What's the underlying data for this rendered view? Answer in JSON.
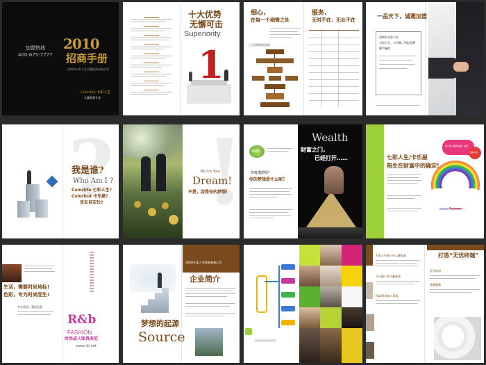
{
  "cover": {
    "hotline_label": "加盟热线",
    "hotline_number": "400-675-7777",
    "year": "2010",
    "title": "招商手册",
    "company_note": "深圳市七彩人生儿童家具有限公司",
    "brand": "Colorlife 七彩人生",
    "brand_sub": "儿童家具专卖"
  },
  "superiority": {
    "title_cn_line1": "十大优势",
    "title_cn_line2": "无懈可击",
    "title_en": "Superiority",
    "big_number": "1"
  },
  "service": {
    "left_line1": "细心，",
    "left_line2": "在每一个细微之处",
    "right_line1": "服务，",
    "right_line2": "无时不在，无处不在",
    "flow_label": "三大品牌规划流程"
  },
  "partner": {
    "title": "一品天下，诚邀加盟",
    "company_line1": "深圳市七彩人生",
    "company_line2": "七彩人生，卡乐屋，色彩品牌",
    "company_line3": "客户服务"
  },
  "whoami": {
    "title_cn": "我是谁?",
    "title_en": "Who Am I ?",
    "line1": "Colorlife 七彩人生?",
    "line2": "Colorbut 卡乐屋?",
    "line3": "良友自安社?"
  },
  "dream": {
    "title_en": "Dream!",
    "subtitle": "No,I'm Your",
    "caption": "不是，我是你的梦想!"
  },
  "question": {
    "q1": "你有理想吗？",
    "q2": "你的梦想是什么呢？",
    "bubble": "我的梦想"
  },
  "wealth": {
    "title_en": "Wealth",
    "title_cn_line1": "财富之门，",
    "title_cn_line2": "已经打开……"
  },
  "kids": {
    "heading_line1": "七彩人生/卡乐屋",
    "heading_line2": "陪生在财富中的确定!",
    "bubble": "青少年儿童家具第一品牌",
    "url": "www.7cj.com",
    "badge": "七彩人生"
  },
  "fashion": {
    "text_line1": "生活，需要时尚地标!",
    "text_line2": "色彩，专为时尚而生!",
    "sub": "专业家居，潮流无限",
    "logo": "R&b",
    "logo_en": "FASHION",
    "logo_cn": "时尚成人家具典范",
    "url": "www.rbj.net"
  },
  "source": {
    "company": "深圳市七彩人生家具有限公司",
    "title": "企业简介",
    "dream_cn": "梦想的起源",
    "dream_en": "Source"
  },
  "terminal": {
    "title": "打造“无忧终端”",
    "item1": "七彩人生青少年儿童家具",
    "item2": "卡乐屋少年儿童家具",
    "item3": "R&b时尚成人家具",
    "item4": "专业培训",
    "item5": "终端管理"
  }
}
